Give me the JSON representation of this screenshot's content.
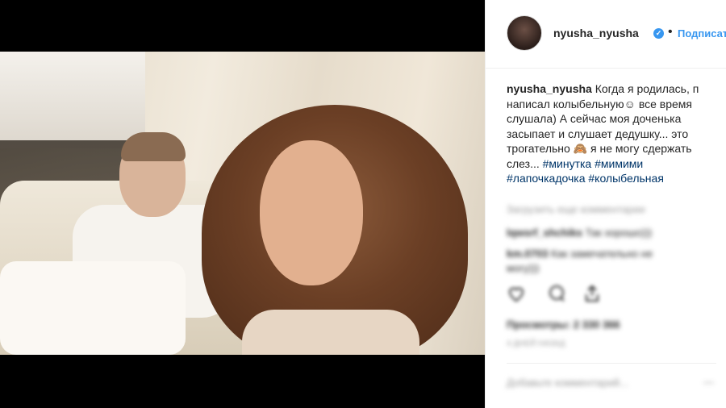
{
  "post": {
    "username": "nyusha_nyusha",
    "follow_label": "Подписаться",
    "dot": "•",
    "caption_user": "nyusha_nyusha",
    "caption_text": " Когда я родилась, п\nнаписал колыбельную☺ все время\nслушала) А сейчас моя доченька\nзасыпает и слушает дедушку... это\nтрогательно 🙈 я не могу сдержать\nслез... ",
    "hashtags": [
      "#минутка",
      "#мимими",
      "#лапочкадочка",
      "#колыбельная"
    ]
  },
  "comments": {
    "load_more": "Загрузить еще комментарии",
    "items": [
      {
        "user": "lqwsrf_shchiks",
        "text": "Так хорошо)))"
      },
      {
        "user": "km.0703",
        "text": "Как замечательно не"
      },
      {
        "user": "",
        "text": "могу)))"
      }
    ]
  },
  "stats": {
    "views": "Просмотры: 2 330 366",
    "date": "4 ДНЕЙ НАЗАД"
  },
  "comment_input": {
    "placeholder": "Добавьте комментарий..."
  },
  "colors": {
    "accent": "#3897f0",
    "hashtag": "#003569",
    "text": "#262626"
  },
  "icons": [
    "heart-icon",
    "comment-icon",
    "share-icon",
    "verified-icon"
  ]
}
